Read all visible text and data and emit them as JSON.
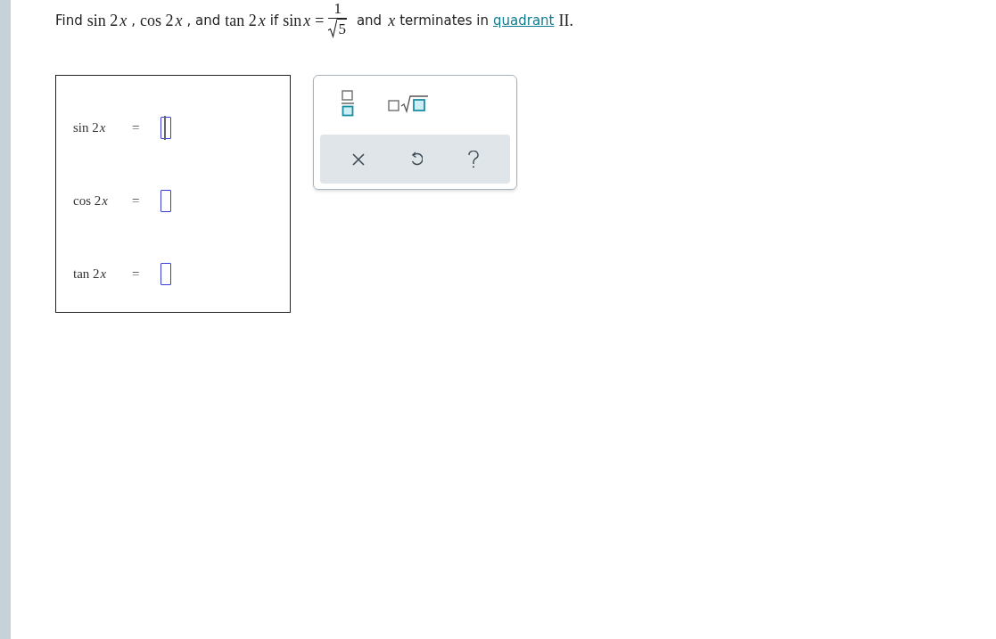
{
  "question": {
    "parts": [
      {
        "kind": "text",
        "text": "Find"
      },
      {
        "kind": "math",
        "text": "sin 2"
      },
      {
        "kind": "var",
        "text": "x"
      },
      {
        "kind": "text",
        "text": ","
      },
      {
        "kind": "math",
        "text": "cos 2"
      },
      {
        "kind": "var",
        "text": "x"
      },
      {
        "kind": "text",
        "text": ", and"
      },
      {
        "kind": "math",
        "text": "tan 2"
      },
      {
        "kind": "var",
        "text": "x"
      },
      {
        "kind": "text",
        "text": "if"
      },
      {
        "kind": "math",
        "text": "sin"
      },
      {
        "kind": "var",
        "text": "x"
      },
      {
        "kind": "math",
        "text": "="
      },
      {
        "kind": "fraction",
        "numerator": "1",
        "radicand": "5"
      },
      {
        "kind": "text",
        "text": "and"
      },
      {
        "kind": "var",
        "text": "x"
      },
      {
        "kind": "text",
        "text": "terminates in"
      },
      {
        "kind": "link",
        "text": "quadrant"
      },
      {
        "kind": "math",
        "text": "II."
      }
    ]
  },
  "answers": [
    {
      "label": "sin 2",
      "variable": "x",
      "sign": "=",
      "focused": true
    },
    {
      "label": "cos 2",
      "variable": "x",
      "sign": "=",
      "focused": false
    },
    {
      "label": "tan 2",
      "variable": "x",
      "sign": "=",
      "focused": false
    }
  ],
  "palette": {
    "tools": [
      {
        "kind": "fraction"
      },
      {
        "kind": "root"
      }
    ],
    "actions": [
      {
        "kind": "clear"
      },
      {
        "kind": "undo"
      },
      {
        "kind": "help"
      }
    ]
  }
}
